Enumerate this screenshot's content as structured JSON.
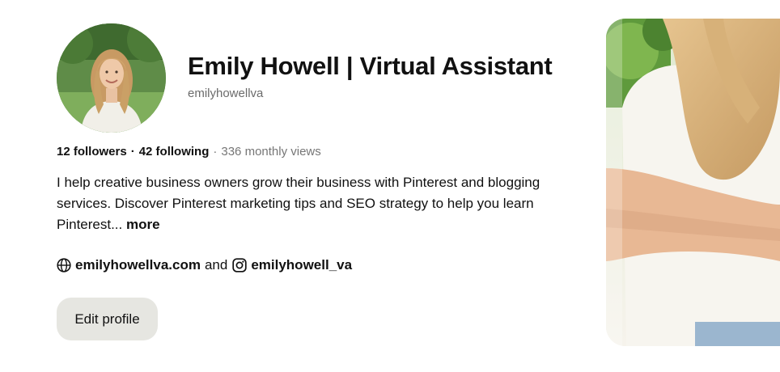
{
  "profile": {
    "display_name": "Emily Howell | Virtual Assistant",
    "username": "emilyhowellva",
    "avatar_alt": "profile photo"
  },
  "stats": {
    "followers": "12 followers",
    "following": "42 following",
    "monthly_views": "336 monthly views",
    "separator": "·"
  },
  "bio": {
    "text": "I help creative business owners grow their business with Pinterest and blogging services. Discover Pinterest marketing tips and SEO strategy to help you learn Pinterest...",
    "more_label": "more"
  },
  "links": {
    "website": "emilyhowellva.com",
    "connector": "and",
    "instagram": "emilyhowell_va",
    "website_icon": "globe-icon",
    "instagram_icon": "instagram-icon"
  },
  "actions": {
    "edit_profile_label": "Edit profile"
  },
  "colors": {
    "button_bg": "#e6e6e1",
    "muted_text": "#767676",
    "primary_text": "#111111"
  }
}
